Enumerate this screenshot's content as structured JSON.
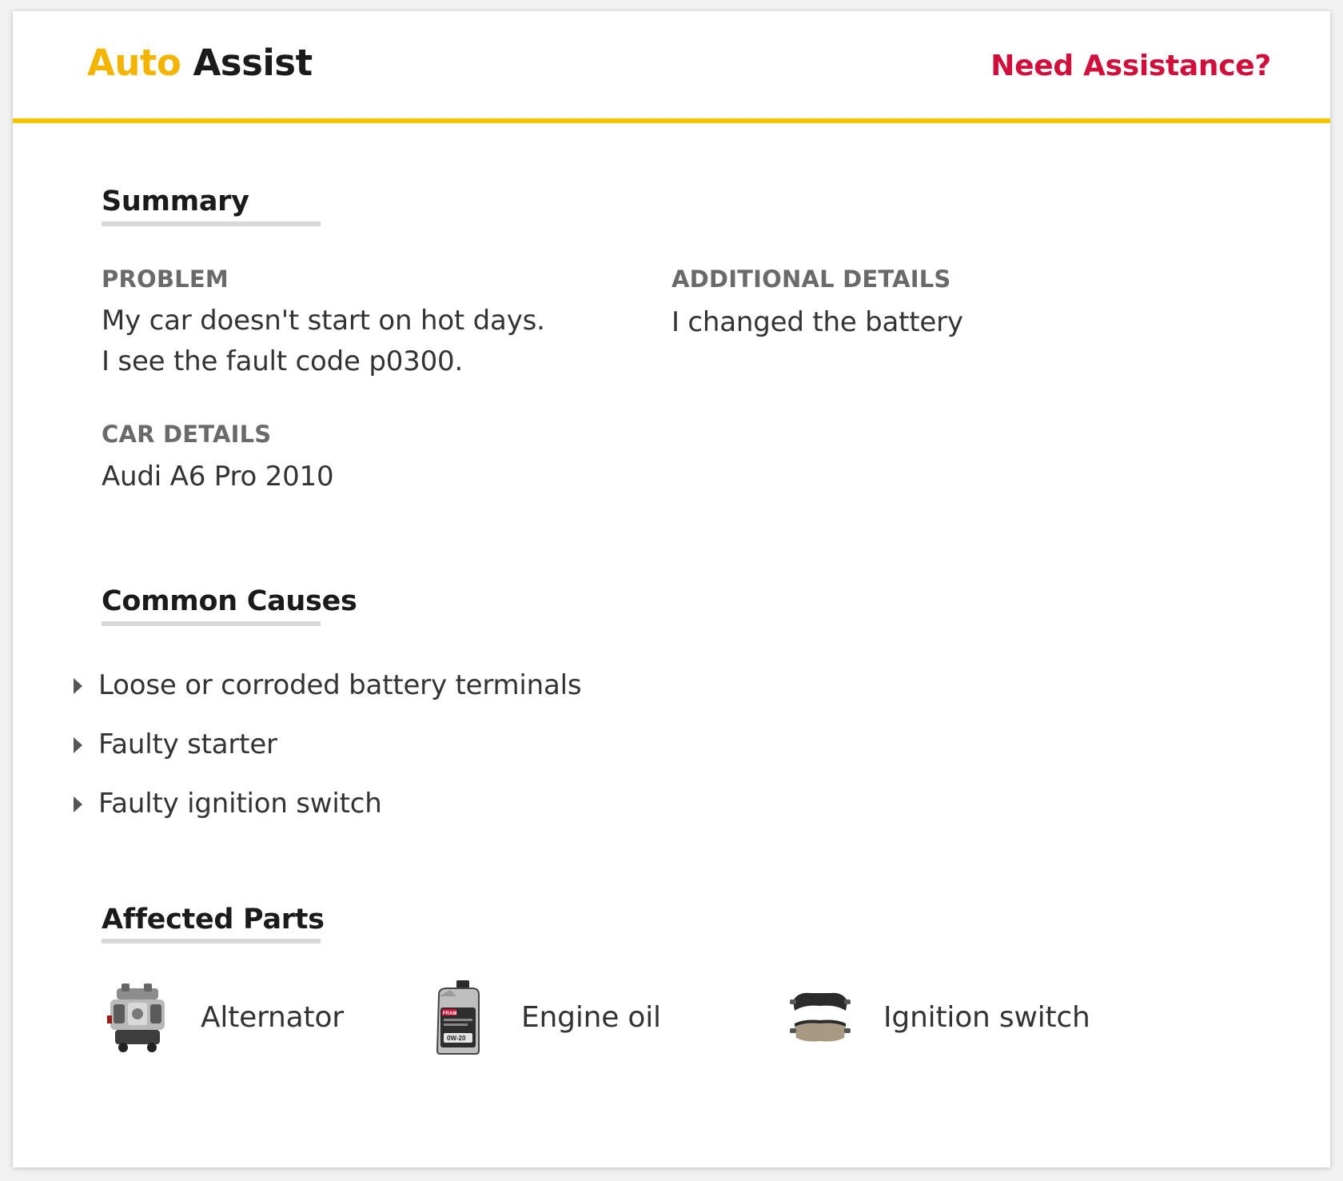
{
  "header": {
    "brand_accent": "Auto",
    "brand_main": "Assist",
    "help_link": "Need Assistance?"
  },
  "summary": {
    "title": "Summary",
    "problem_label": "PROBLEM",
    "problem_line1": "My car doesn't start on hot days.",
    "problem_line2": "I see the fault code p0300.",
    "additional_label": "ADDITIONAL DETAILS",
    "additional_value": "I changed the battery",
    "car_label": "CAR DETAILS",
    "car_value": "Audi A6 Pro 2010"
  },
  "causes": {
    "title": "Common Causes",
    "items": [
      {
        "label": "Loose or corroded battery terminals",
        "icon": "caret-right-icon"
      },
      {
        "label": "Faulty starter",
        "icon": "caret-right-icon"
      },
      {
        "label": "Faulty ignition switch",
        "icon": "caret-right-icon"
      }
    ]
  },
  "parts": {
    "title": "Affected Parts",
    "items": [
      {
        "label": "Alternator",
        "icon": "engine-icon"
      },
      {
        "label": "Engine oil",
        "icon": "oil-jug-icon"
      },
      {
        "label": "Ignition switch",
        "icon": "brake-pads-icon"
      }
    ],
    "oil_brand": "FRAM",
    "oil_grade": "0W-20"
  },
  "colors": {
    "accent_yellow": "#f5c400",
    "brand_yellow": "#f5b400",
    "link_red": "#d0103a"
  }
}
